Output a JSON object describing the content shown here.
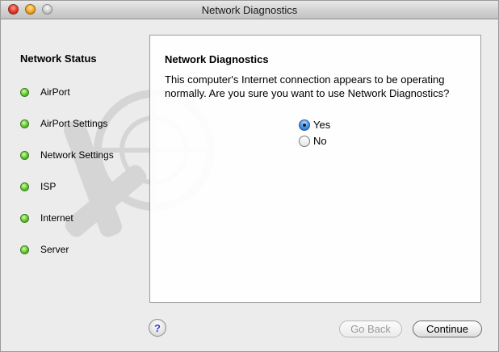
{
  "window": {
    "title": "Network Diagnostics"
  },
  "sidebar": {
    "heading": "Network Status",
    "items": [
      {
        "label": "AirPort",
        "status": "green"
      },
      {
        "label": "AirPort Settings",
        "status": "green"
      },
      {
        "label": "Network Settings",
        "status": "green"
      },
      {
        "label": "ISP",
        "status": "green"
      },
      {
        "label": "Internet",
        "status": "green"
      },
      {
        "label": "Server",
        "status": "green"
      }
    ]
  },
  "panel": {
    "title": "Network Diagnostics",
    "message": "This computer's Internet connection appears to be operating normally. Are you sure you want to use Network Diagnostics?",
    "options": [
      {
        "label": "Yes",
        "selected": true
      },
      {
        "label": "No",
        "selected": false
      }
    ]
  },
  "footer": {
    "help_label": "?",
    "back_label": "Go Back",
    "back_enabled": false,
    "continue_label": "Continue"
  },
  "colors": {
    "status_ok": "#6fd23b",
    "radio_selected": "#4a96e6",
    "help_glyph": "#3b3ad6"
  }
}
